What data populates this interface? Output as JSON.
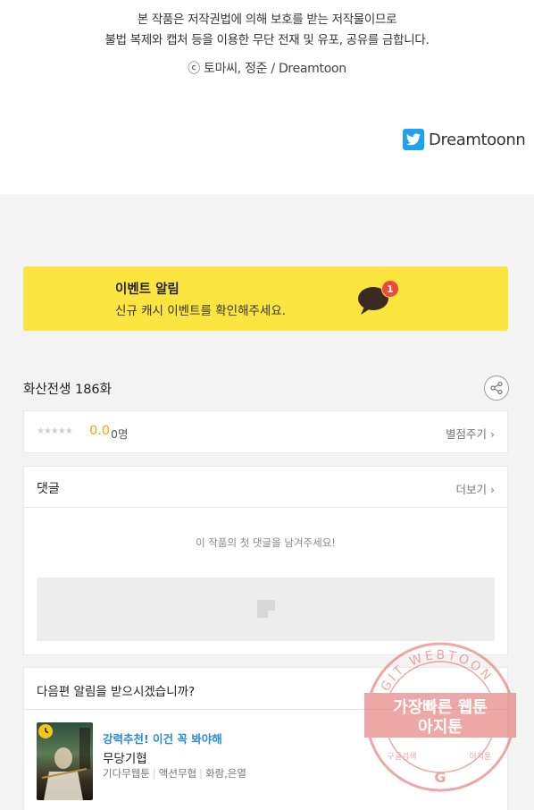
{
  "copyright": {
    "line1": "본 작품은 저작권법에 의해 보호를 받는 저작물이므로",
    "line2": "불법 복제와 캡처 등을 이용한 무단 전재 및 유포, 공유를 금합니다.",
    "line3": "ⓒ 토마씨, 정준 / Dreamtoon"
  },
  "twitter": {
    "handle": "Dreamtoonn",
    "icon": "twitter-icon",
    "color": "#1da1f2"
  },
  "event": {
    "title": "이벤트 알림",
    "subtitle": "신규 캐시 이벤트를 확인해주세요.",
    "badge_count": "1",
    "background": "#fde53f"
  },
  "episode": {
    "title": "화산전생 186화"
  },
  "rating": {
    "stars": "★★★★★",
    "score": "0.0",
    "votes": "0명",
    "rate_label": "별점주기",
    "chevron": "›",
    "score_color": "#f3a300"
  },
  "comments": {
    "title": "댓글",
    "more_label": "더보기",
    "chevron": "›",
    "empty_message": "이 작품의 첫 댓글을 남겨주세요!"
  },
  "next_episode": {
    "prompt": "다음편 알림을 받으시겠습니까?",
    "recommend": {
      "tag": "강력추천! 이건 꼭 봐야해",
      "name": "무당기협",
      "genre1": "기다무웹툰",
      "genre2": "액션무협",
      "authors": "화람,은열"
    }
  },
  "watermark": {
    "ring_text": "AGIT WEBTOON",
    "line1": "가장빠른 웹툰",
    "line2": "아지툰",
    "bottom_left": "구글검색",
    "bottom_right": "아지툰",
    "color": "#e0605a"
  }
}
